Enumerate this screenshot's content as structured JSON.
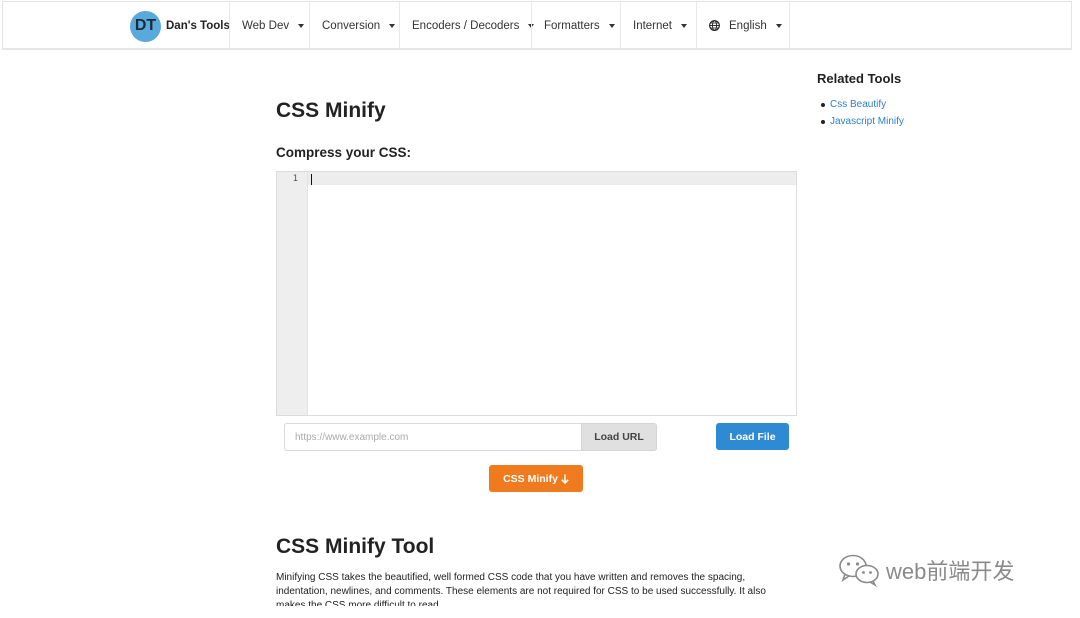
{
  "nav": {
    "brand_logo": "DT",
    "brand_name": "Dan's Tools",
    "items": [
      {
        "label": "Web Dev"
      },
      {
        "label": "Conversion"
      },
      {
        "label": "Encoders / Decoders"
      },
      {
        "label": "Formatters"
      },
      {
        "label": "Internet"
      }
    ],
    "language": "English",
    "language_icon": "globe-icon"
  },
  "main": {
    "page_title": "CSS Minify",
    "subtitle": "Compress your CSS:",
    "editor": {
      "line_numbers": [
        "1"
      ],
      "content": ""
    },
    "url_placeholder": "https://www.example.com",
    "load_url_label": "Load URL",
    "load_file_label": "Load File",
    "minify_label": "CSS Minify",
    "minify_icon": "arrow-down-icon",
    "tool_title": "CSS Minify Tool",
    "tool_description": "Minifying CSS takes the beautified, well formed CSS code that you have written and removes the spacing, indentation, newlines, and comments. These elements are not required for CSS to be used successfully. It also makes the CSS more difficult to read."
  },
  "sidebar": {
    "title": "Related Tools",
    "links": [
      "Css Beautify",
      "Javascript Minify"
    ]
  },
  "watermark": {
    "text": "web前端开发",
    "icon": "wechat-icon"
  },
  "colors": {
    "brand": "#5aa9dc",
    "primary": "#2d8ad3",
    "accent": "#f07b1e",
    "link": "#2d7fc5"
  }
}
